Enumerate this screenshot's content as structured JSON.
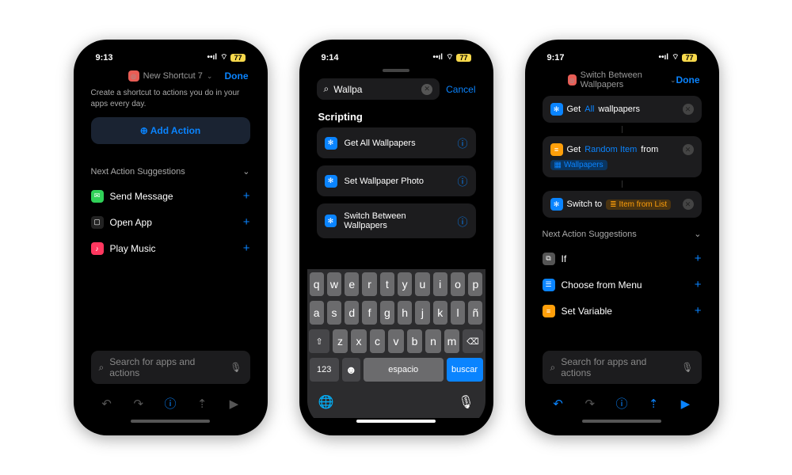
{
  "status": {
    "times": [
      "9:13",
      "9:14",
      "9:17"
    ],
    "battery": "77"
  },
  "done": "Done",
  "p1": {
    "title": "New Shortcut 7",
    "hint": "Create a shortcut to actions you do in your apps every day.",
    "add": "Add Action",
    "sugg_head": "Next Action Suggestions",
    "suggs": [
      {
        "label": "Send Message",
        "bg": "green",
        "glyph": "✉"
      },
      {
        "label": "Open App",
        "bg": "black-icon",
        "glyph": "▢"
      },
      {
        "label": "Play Music",
        "bg": "pink",
        "glyph": "♪"
      }
    ],
    "search_ph": "Search for apps and actions"
  },
  "p2": {
    "query": "Wallpa",
    "cancel": "Cancel",
    "group": "Scripting",
    "results": [
      "Get All Wallpapers",
      "Set Wallpaper Photo",
      "Switch Between Wallpapers"
    ],
    "kbd": {
      "row1": [
        "q",
        "w",
        "e",
        "r",
        "t",
        "y",
        "u",
        "i",
        "o",
        "p"
      ],
      "row2": [
        "a",
        "s",
        "d",
        "f",
        "g",
        "h",
        "j",
        "k",
        "l",
        "ñ"
      ],
      "row3": [
        "⇧",
        "z",
        "x",
        "c",
        "v",
        "b",
        "n",
        "m",
        "⌫"
      ],
      "num": "123",
      "emoji": "☻",
      "space": "espacio",
      "go": "buscar"
    }
  },
  "p3": {
    "title": "Switch Between Wallpapers",
    "actions": {
      "a1": {
        "verb": "Get",
        "arg1": "All",
        "arg2": "wallpapers"
      },
      "a2": {
        "verb": "Get",
        "arg1": "Random Item",
        "from": "from",
        "ref": "Wallpapers"
      },
      "a3": {
        "verb": "Switch to",
        "ref": "Item from List"
      }
    },
    "sugg_head": "Next Action Suggestions",
    "suggs": [
      {
        "label": "If",
        "bg": "gray"
      },
      {
        "label": "Choose from Menu",
        "bg": "blue"
      },
      {
        "label": "Set Variable",
        "bg": "orange"
      }
    ],
    "search_ph": "Search for apps and actions"
  }
}
